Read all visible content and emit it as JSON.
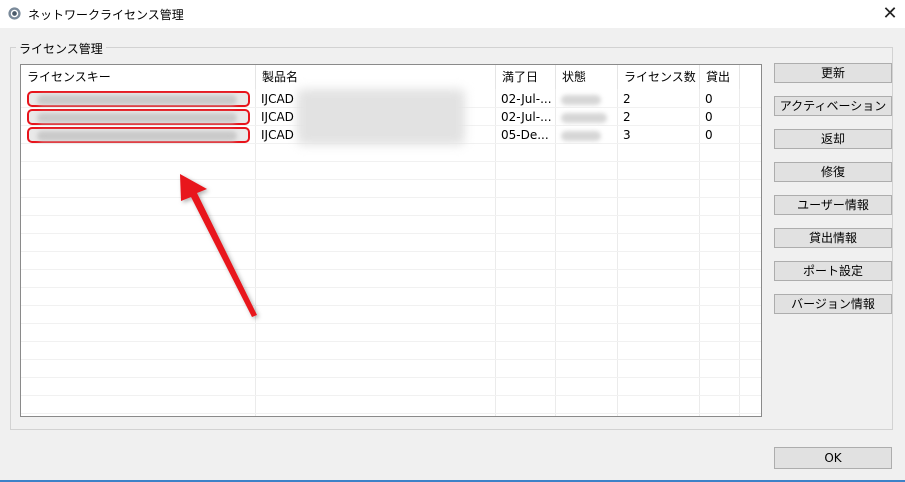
{
  "window": {
    "title": "ネットワークライセンス管理",
    "close_glyph": "✕",
    "app_icon": "gear-icon"
  },
  "group": {
    "label": "ライセンス管理"
  },
  "table": {
    "columns": [
      "ライセンスキー",
      "製品名",
      "満了日",
      "状態",
      "ライセンス数",
      "貸出"
    ],
    "rows": [
      {
        "product": "IJCAD",
        "expiry": "02-Jul-...",
        "count": "2",
        "lent": "0"
      },
      {
        "product": "IJCAD",
        "expiry": "02-Jul-...",
        "count": "2",
        "lent": "0"
      },
      {
        "product": "IJCAD",
        "expiry": "05-De...",
        "count": "3",
        "lent": "0"
      }
    ]
  },
  "buttons": {
    "refresh": "更新",
    "activate": "アクティベーション",
    "return": "返却",
    "repair": "修復",
    "user_info": "ユーザー情報",
    "lend_info": "貸出情報",
    "port_settings": "ポート設定",
    "version_info": "バージョン情報",
    "ok": "OK"
  },
  "annotation": {
    "color": "#e8141c"
  }
}
